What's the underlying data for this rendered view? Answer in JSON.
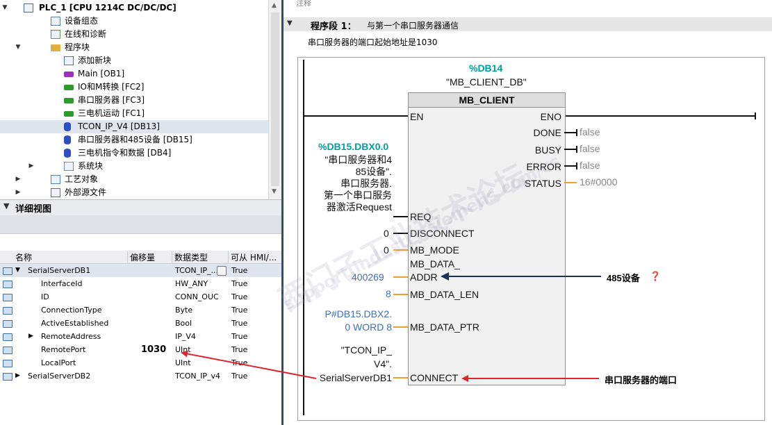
{
  "tree": {
    "items": [
      {
        "label": "PLC_1 [CPU 1214C DC/DC/DC]",
        "icon": "plc-icon",
        "arrow": "▼",
        "indent": 0
      },
      {
        "label": "设备组态",
        "icon": "device-config-icon",
        "arrow": "",
        "indent": 1
      },
      {
        "label": "在线和诊断",
        "icon": "online-diagnostics-icon",
        "arrow": "",
        "indent": 1
      },
      {
        "label": "程序块",
        "icon": "folder-icon",
        "arrow": "▼",
        "indent": 1
      },
      {
        "label": "添加新块",
        "icon": "add-block-icon",
        "arrow": "",
        "indent": 2
      },
      {
        "label": "Main [OB1]",
        "icon": "ob-block-icon",
        "arrow": "",
        "indent": 2
      },
      {
        "label": "IO和M转换 [FC2]",
        "icon": "fc-block-icon",
        "arrow": "",
        "indent": 2
      },
      {
        "label": "串口服务器 [FC3]",
        "icon": "fc-block-icon",
        "arrow": "",
        "indent": 2
      },
      {
        "label": "三电机运动 [FC1]",
        "icon": "fc-block-icon",
        "arrow": "",
        "indent": 2
      },
      {
        "label": "TCON_IP_V4 [DB13]",
        "icon": "db-block-icon",
        "arrow": "",
        "indent": 2
      },
      {
        "label": "串口服务器和485设备 [DB15]",
        "icon": "db-block-icon",
        "arrow": "",
        "indent": 2
      },
      {
        "label": "三电机指令和数据 [DB4]",
        "icon": "db-block-icon",
        "arrow": "",
        "indent": 2
      },
      {
        "label": "系统块",
        "icon": "system-block-icon",
        "arrow": "▶",
        "indent": 2
      },
      {
        "label": "工艺对象",
        "icon": "technology-object-icon",
        "arrow": "▶",
        "indent": 1
      },
      {
        "label": "外部源文件",
        "icon": "external-source-icon",
        "arrow": "▶",
        "indent": 1
      }
    ]
  },
  "detail": {
    "title": "详细视图",
    "columns": [
      "名称",
      "偏移量",
      "数据类型",
      "可从 HMI/..."
    ],
    "rows": [
      {
        "name": "SerialServerDB1",
        "offset": "",
        "type": "TCON_IP_...",
        "hmi": "True",
        "arrow": "▼",
        "level": 0
      },
      {
        "name": "InterfaceId",
        "offset": "",
        "type": "HW_ANY",
        "hmi": "True",
        "arrow": "",
        "level": 1
      },
      {
        "name": "ID",
        "offset": "",
        "type": "CONN_OUC",
        "hmi": "True",
        "arrow": "",
        "level": 1
      },
      {
        "name": "ConnectionType",
        "offset": "",
        "type": "Byte",
        "hmi": "True",
        "arrow": "",
        "level": 1
      },
      {
        "name": "ActiveEstablished",
        "offset": "",
        "type": "Bool",
        "hmi": "True",
        "arrow": "",
        "level": 1
      },
      {
        "name": "RemoteAddress",
        "offset": "",
        "type": "IP_V4",
        "hmi": "True",
        "arrow": "▶",
        "level": 1
      },
      {
        "name": "RemotePort",
        "offset": "1030",
        "type": "UInt",
        "hmi": "True",
        "arrow": "",
        "level": 1
      },
      {
        "name": "LocalPort",
        "offset": "",
        "type": "UInt",
        "hmi": "True",
        "arrow": "",
        "level": 1
      },
      {
        "name": "SerialServerDB2",
        "offset": "",
        "type": "TCON_IP_v4",
        "hmi": "True",
        "arrow": "▶",
        "level": 0
      }
    ]
  },
  "editor": {
    "comment_label": "注释",
    "segment_title": "程序段 1：",
    "segment_desc": "与第一个串口服务器通信",
    "segment_comment": "串口服务器的端口起始地址是1030"
  },
  "block": {
    "instance_db": "%DB14",
    "instance_name": "\"MB_CLIENT_DB\"",
    "type": "MB_CLIENT",
    "inputs": {
      "en": "EN",
      "req": "REQ",
      "disconnect": "DISCONNECT",
      "mb_mode": "MB_MODE",
      "mb_data_addr_1": "MB_DATA_",
      "mb_data_addr_2": "ADDR",
      "mb_data_len": "MB_DATA_LEN",
      "mb_data_ptr": "MB_DATA_PTR",
      "connect": "CONNECT"
    },
    "outputs": {
      "eno": "ENO",
      "done": "DONE",
      "busy": "BUSY",
      "error": "ERROR",
      "status": "STATUS"
    },
    "output_values": {
      "done": "false",
      "busy": "false",
      "error": "false",
      "status": "16#0000"
    },
    "input_values": {
      "req_addr": "%DB15.DBX0.0",
      "req_lines": [
        "\"串口服务器和4",
        "85设备\".",
        "串口服务器.",
        "第一个串口服务",
        "器激活Request"
      ],
      "disconnect": "0",
      "mb_mode": "0",
      "mb_data_addr": "400269",
      "mb_data_len": "8",
      "mb_data_ptr_1": "P#DB15.DBX2.",
      "mb_data_ptr_2": "0 WORD 8",
      "connect_lines": [
        "\"TCON_IP_",
        "V4\".",
        "SerialServerDB1"
      ]
    }
  },
  "annotations": {
    "addr_note": "485设备",
    "addr_mark": "❓",
    "connect_note": "串口服务器的端口"
  },
  "watermark": {
    "line1": "西门子工业技术论坛",
    "line2": "support.industry.siemens.com/cs"
  }
}
